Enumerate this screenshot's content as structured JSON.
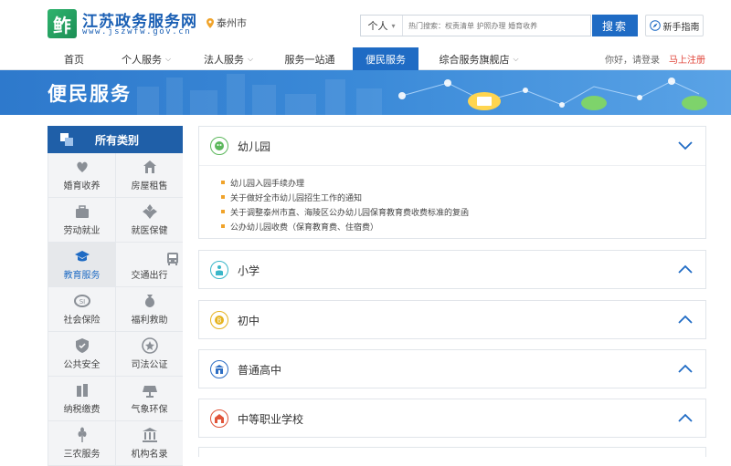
{
  "header": {
    "logo_char": "鲊",
    "site_title": "江苏政务服务网",
    "site_url": "www.jszwfw.gov.cn",
    "city": "泰州市",
    "search_type": "个人",
    "search_placeholder": "热门搜索：权责清单 护照办理 婚育收养",
    "search_button": "搜索",
    "guide_button": "新手指南"
  },
  "nav": {
    "items": [
      "首页",
      "个人服务",
      "法人服务",
      "服务一站通",
      "便民服务",
      "综合服务旗舰店"
    ],
    "active_index": 4,
    "greeting": "你好，请登录",
    "register": "马上注册"
  },
  "banner": {
    "title": "便民服务"
  },
  "sidebar": {
    "title": "所有类别",
    "categories": [
      {
        "label": "婚育收养",
        "icon": "rings-icon"
      },
      {
        "label": "房屋租售",
        "icon": "house-icon"
      },
      {
        "label": "劳动就业",
        "icon": "briefcase-icon"
      },
      {
        "label": "就医保健",
        "icon": "medical-cross-icon"
      },
      {
        "label": "教育服务",
        "icon": "graduation-cap-icon",
        "active": true
      },
      {
        "label": "交通出行",
        "icon": "bus-icon"
      },
      {
        "label": "社会保险",
        "icon": "social-insurance-icon"
      },
      {
        "label": "福利救助",
        "icon": "money-bag-icon"
      },
      {
        "label": "公共安全",
        "icon": "shield-icon"
      },
      {
        "label": "司法公证",
        "icon": "badge-star-icon"
      },
      {
        "label": "纳税缴费",
        "icon": "tax-icon"
      },
      {
        "label": "气象环保",
        "icon": "solar-panel-icon"
      },
      {
        "label": "三农服务",
        "icon": "wheat-icon"
      },
      {
        "label": "机构名录",
        "icon": "institution-icon"
      }
    ]
  },
  "panels": [
    {
      "title": "幼儿园",
      "icon": "kindergarten-icon",
      "color": "#5cb85c",
      "expanded": true,
      "links": [
        "幼儿园入园手续办理",
        "关于做好全市幼儿园招生工作的通知",
        "关于调整泰州市直、海陵区公办幼儿园保育教育费收费标准的复函",
        "公办幼儿园收费（保育教育费、住宿费）"
      ]
    },
    {
      "title": "小学",
      "icon": "student-icon",
      "color": "#3bb7c9",
      "expanded": false
    },
    {
      "title": "初中",
      "icon": "junior-high-icon",
      "color": "#e6b422",
      "expanded": false
    },
    {
      "title": "普通高中",
      "icon": "high-school-icon",
      "color": "#2f6fc4",
      "expanded": false
    },
    {
      "title": "中等职业学校",
      "icon": "vocational-school-icon",
      "color": "#e0553a",
      "expanded": false
    }
  ],
  "colors": {
    "primary": "#1f6bc4",
    "sidebar_head": "#1f5fa8",
    "register": "#e0453a",
    "bullet": "#f0a32a"
  }
}
